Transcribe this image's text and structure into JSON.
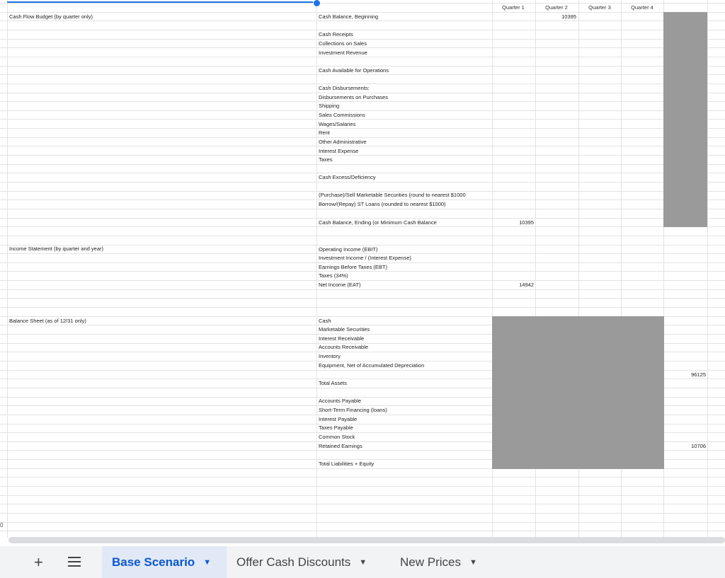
{
  "columns": {
    "q1": "Quarter 1",
    "q2": "Quarter 2",
    "q3": "Quarter 3",
    "q4": "Quarter 4"
  },
  "sections": {
    "cash_flow": "Cash Flow Budget (by quarter only)",
    "income": "Income Statement (by quarter and year)",
    "balance": "Balance Sheet (as of 12/31 only)"
  },
  "labels": {
    "cash_balance_beginning": "Cash Balance, Beginning",
    "cash_receipts": "Cash Receipts",
    "collections_on_sales": "Collections on Sales",
    "investment_revenue": "Investment Revenue",
    "cash_available": "Cash Available for Operations",
    "cash_disbursements": "Cash Disbursements:",
    "disbursements_purchases": "Disbursements on Purchases",
    "shipping": "Shipping",
    "sales_commissions": "Sales Commissions",
    "wages_salaries": "Wages/Salaries",
    "rent": "Rent",
    "other_admin": "Other Administrative",
    "interest_expense": "Interest Expense",
    "taxes": "Taxes",
    "cash_excess": "Cash Excess/Deficiency",
    "purchase_sell": "(Purchase)/Sell Marketable Securities (round to nearest $1000",
    "borrow_repay": "Borrow/(Repay) ST Loans (rounded to nearest $1000)",
    "cash_balance_ending": "Cash Balance, Ending (or Minimum Cash Balance",
    "operating_income": "Operating Income (EBIT)",
    "investment_income": "Investment Income / (Interest Expense)",
    "ebt": "Earnings Before Taxes (EBT)",
    "taxes_34": "Taxes (34%)",
    "net_income": "Net Income (EAT)",
    "cash": "Cash",
    "marketable_securities": "Marketable Securities",
    "interest_receivable": "Interest Receivable",
    "accounts_receivable": "Accounts Receivable",
    "inventory": "Inventory",
    "equipment": "Equipment, Net of Accumulated Depreciation",
    "total_assets": "Total Assets",
    "accounts_payable": "Accounts Payable",
    "short_term_financing": "Short-Term Financing (loans)",
    "interest_payable": "Interest Payable",
    "taxes_payable": "Taxes Payable",
    "common_stock": "Common Stock",
    "retained_earnings": "Retained Earnings",
    "total_liabilities_equity": "Total Liabilities + Equity"
  },
  "values": {
    "q2_beginning": "10395",
    "q1_ending": "10395",
    "q1_net_income": "14942",
    "year_equipment": "96125",
    "year_retained": "10706"
  },
  "row_stub": "0",
  "tabs": {
    "add_icon": "+",
    "tab1": "Base Scenario",
    "tab2": "Offer Cash Discounts",
    "tab3": "New Prices"
  },
  "colors": {
    "accent": "#0b57d0",
    "shade": "#9a9a9a"
  }
}
